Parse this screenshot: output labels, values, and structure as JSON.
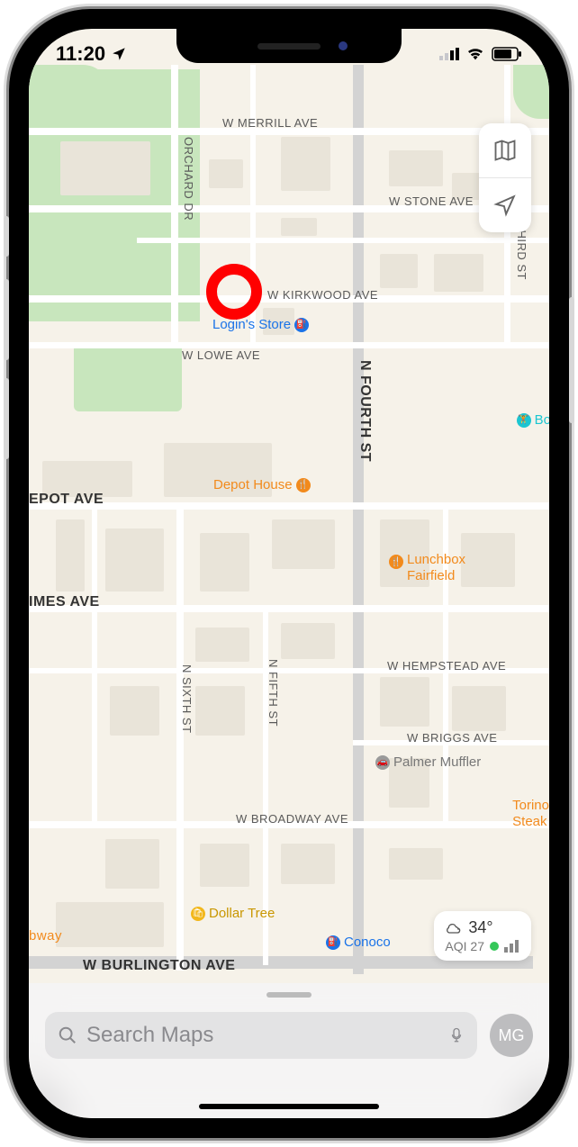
{
  "status": {
    "time": "11:20",
    "location_icon": "location-arrow-icon",
    "signal_icon": "cell-signal-icon",
    "wifi_icon": "wifi-icon",
    "battery_icon": "battery-icon"
  },
  "controls": {
    "mode_icon": "map-mode-icon",
    "locate_icon": "location-arrow-icon"
  },
  "streets": {
    "w_merrill": "W MERRILL AVE",
    "orchard": "ORCHARD DR",
    "w_stone": "W STONE AVE",
    "w_kirkwood": "W KIRKWOOD AVE",
    "third": "THIRD ST",
    "w_lowe": "W LOWE AVE",
    "n_fourth": "N FOURTH ST",
    "depot": "EPOT AVE",
    "grimes": "IMES AVE",
    "n_sixth": "N SIXTH ST",
    "n_fifth": "N FIFTH ST",
    "w_hempstead": "W HEMPSTEAD AVE",
    "w_briggs": "W BRIGGS AVE",
    "w_broadway": "W BROADWAY AVE",
    "w_burlington": "W BURLINGTON AVE",
    "bway_clip": "bway"
  },
  "pois": {
    "logins_store": "Login's Store",
    "bo_clip": "Bo",
    "depot_house": "Depot House",
    "lunchbox": "Lunchbox\nFairfield",
    "palmer": "Palmer Muffler",
    "torino": "Torino\nSteak",
    "dollar_tree": "Dollar Tree",
    "conoco": "Conoco"
  },
  "colors": {
    "restaurant": "#f28a1c",
    "shopping": "#f2b71c",
    "fuel": "#1a73e8",
    "fitness": "#1bc6d1"
  },
  "weather": {
    "temp": "34°",
    "aqi_label": "AQI 27",
    "aqi_color": "#35c759",
    "chart_icon": "bar-mini-icon",
    "cloud_icon": "cloud-icon"
  },
  "search": {
    "placeholder": "Search Maps",
    "icon": "search-icon",
    "mic_icon": "microphone-icon"
  },
  "profile": {
    "initials": "MG"
  },
  "highlight": {
    "present": true
  }
}
